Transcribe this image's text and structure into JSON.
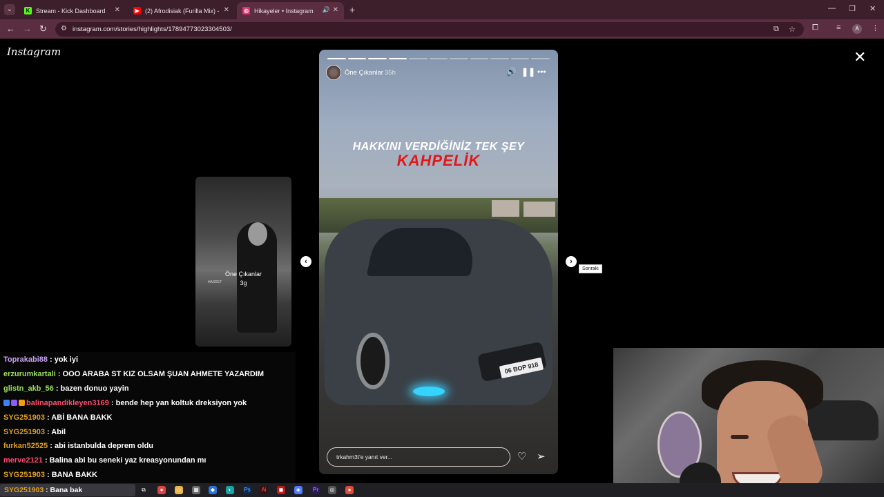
{
  "browser": {
    "tabs": [
      {
        "label": "Stream - Kick Dashboard",
        "favicon": "kick-icon",
        "color": "#53fc18"
      },
      {
        "label": "(2) Afrodisiak (Furilla Mix) - Fur",
        "favicon": "youtube-icon",
        "color": "#ff0000"
      },
      {
        "label": "Hikayeler • Instagram",
        "favicon": "instagram-icon",
        "color": "#e1306c"
      }
    ],
    "url": "instagram.com/stories/highlights/17894773023304503/",
    "profile_initial": "A"
  },
  "instagram": {
    "logo": "Instagram",
    "prev_story": {
      "title": "Öne Çıkanlar",
      "age": "3g",
      "overlay_text": "HASRET"
    },
    "story": {
      "username": "Öne Çıkanlar",
      "time": "35h",
      "progress_total": 11,
      "progress_done": 4,
      "headline_line1": "HAKKINI VERDİĞİNİZ TEK ŞEY",
      "headline_line2": "KAHPELİK",
      "plate": "06 BOP 918",
      "reply_placeholder": "trkahm3t'e yanıt ver..."
    },
    "next_tooltip": "Sonraki"
  },
  "chat": [
    {
      "name": "Toprakabi88",
      "color": "#c8a2f0",
      "message": ": yok iyi",
      "badges": []
    },
    {
      "name": "erzurumkartali",
      "color": "#9be05a",
      "message": ": OOO ARABA ST KIZ OLSAM ŞUAN AHMETE YAZARDIM",
      "badges": []
    },
    {
      "name": "glistn_akb_56",
      "color": "#9be05a",
      "message": ": bazen donuo yayin",
      "badges": []
    },
    {
      "name": "balinapandikleyen3169",
      "color": "#ff4d6d",
      "message": ": bende hep yan koltuk dreksiyon yok",
      "badges": [
        "#3b82f6",
        "#8b5cf6",
        "#f59e0b"
      ]
    },
    {
      "name": "SYG251903",
      "color": "#e0a020",
      "message": ": ABİ BANA BAKK",
      "badges": []
    },
    {
      "name": "SYG251903",
      "color": "#e0a020",
      "message": ": Abil",
      "badges": []
    },
    {
      "name": "furkan52525",
      "color": "#e0a020",
      "message": ": abi istanbulda deprem oldu",
      "badges": []
    },
    {
      "name": "merve2121",
      "color": "#ff4d6d",
      "message": ": Balina abi bu seneki yaz kreasyonundan mı",
      "badges": []
    },
    {
      "name": "SYG251903",
      "color": "#e0a020",
      "message": ": BANA BAKK",
      "badges": []
    }
  ],
  "taskbar": {
    "search_name": "SYG251903",
    "search_text": ": Bana bak"
  }
}
